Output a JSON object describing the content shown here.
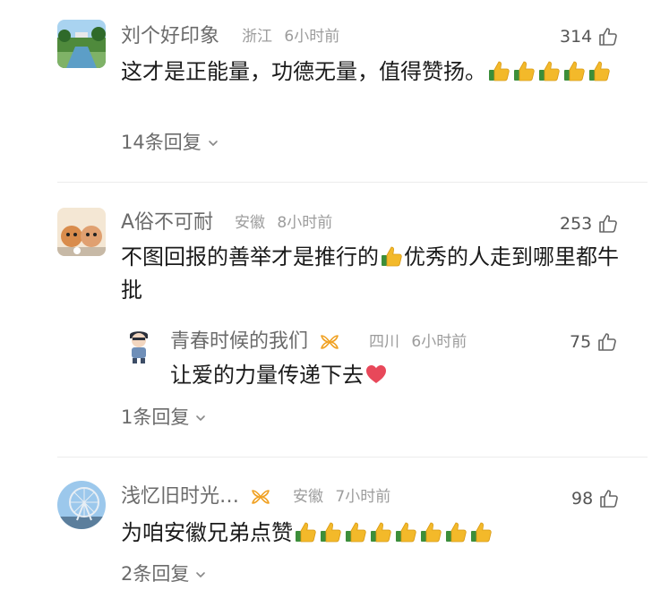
{
  "comments": [
    {
      "username": "刘个好印象",
      "location": "浙江",
      "time": "6小时前",
      "likes": "314",
      "text": "这才是正能量，功德无量，值得赞扬。",
      "emoji_count": 5,
      "replies": "14条回复",
      "avatar_icon": "landscape-photo"
    },
    {
      "username": "A俗不可耐",
      "location": "安徽",
      "time": "8小时前",
      "likes": "253",
      "text_part1": "不图回报的善举才是推行的",
      "text_part2": "优秀的人走到哪里都牛批",
      "avatar_icon": "cartoon-pets",
      "reply": {
        "username": "青春时候的我们",
        "badge_icon": "ribbon-badge",
        "location": "四川",
        "time": "6小时前",
        "likes": "75",
        "text": "让爱的力量传递下去",
        "avatar_icon": "chibi-character"
      },
      "replies": "1条回复"
    },
    {
      "username": "浅忆旧时光…",
      "badge_icon": "ribbon-badge",
      "location": "安徽",
      "time": "7小时前",
      "likes": "98",
      "text": "为咱安徽兄弟点赞",
      "emoji_count": 8,
      "replies": "2条回复",
      "avatar_icon": "ferris-wheel"
    }
  ],
  "colors": {
    "username": "#6b6b6b",
    "meta": "#9c9c9c",
    "body_text": "#1b1b1b",
    "badge": "#f0a020",
    "heart": "#e8485a",
    "thumb": "#f3b92a"
  }
}
